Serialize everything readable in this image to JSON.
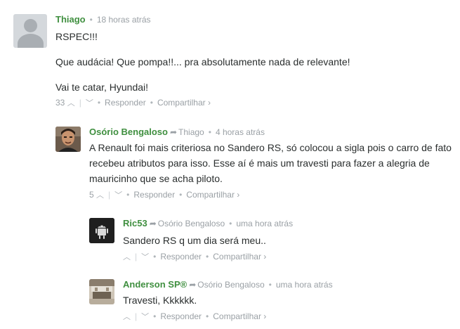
{
  "comments": [
    {
      "author": "Thiago",
      "parent": "",
      "time": "18 horas atrás",
      "paragraphs": [
        "RSPEC!!!",
        "Que audácia! Que pompa!!... pra absolutamente nada de relevante!",
        "Vai te catar, Hyundai!"
      ],
      "upvotes": "33",
      "reply": "Responder",
      "share": "Compartilhar ›",
      "avatar": "default-user-avatar"
    },
    {
      "author": "Osório Bengaloso",
      "parent": "Thiago",
      "time": "4 horas atrás",
      "paragraphs": [
        "A Renault foi mais criteriosa no Sandero RS, só colocou a sigla pois o carro de fato recebeu atributos para isso. Esse aí é mais um travesti para fazer a alegria de mauricinho que se acha piloto."
      ],
      "upvotes": "5",
      "reply": "Responder",
      "share": "Compartilhar ›",
      "avatar": "man-portrait-avatar"
    },
    {
      "author": "Ric53",
      "parent": "Osório Bengaloso",
      "time": "uma hora atrás",
      "paragraphs": [
        "Sandero RS q um dia será meu.."
      ],
      "upvotes": "",
      "reply": "Responder",
      "share": "Compartilhar ›",
      "avatar": "android-robot-avatar"
    },
    {
      "author": "Anderson SP®",
      "parent": "Osório Bengaloso",
      "time": "uma hora atrás",
      "paragraphs": [
        "Travesti, Kkkkkk."
      ],
      "upvotes": "",
      "reply": "Responder",
      "share": "Compartilhar ›",
      "avatar": "room-photo-avatar"
    }
  ],
  "icons": {
    "upvote": "chevron-up-icon",
    "downvote": "chevron-down-icon",
    "reply_arrow": "reply-arrow-icon"
  },
  "colors": {
    "author": "#3f8f3f",
    "meta": "#9aa0a5",
    "text": "#2a2e2e"
  }
}
